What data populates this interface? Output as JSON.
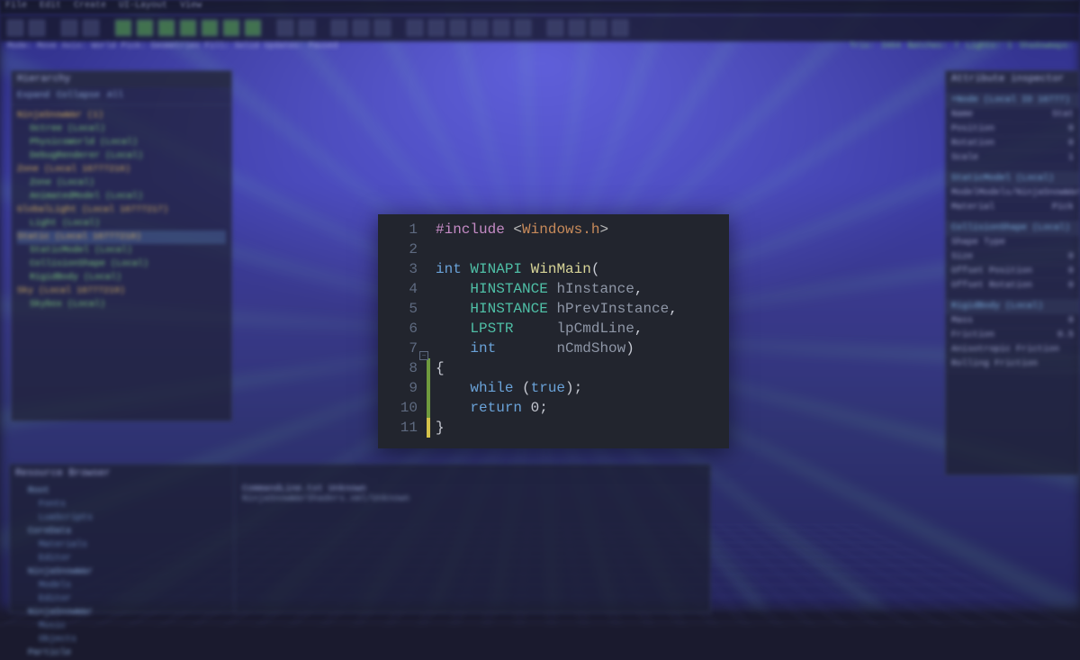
{
  "menu": [
    "File",
    "Edit",
    "Create",
    "UI-Layout",
    "View"
  ],
  "status_left": [
    "Mode:",
    "Move",
    "Axis:",
    "World",
    "Pick:",
    "Geometries",
    "Fill:",
    "Solid",
    "Updates:",
    "Paused"
  ],
  "status_right": [
    "Tris:",
    "3464",
    "Batches:",
    "7",
    "Lights:",
    "1",
    "Shadowmaps:"
  ],
  "hierarchy": {
    "title": "Hierarchy",
    "controls": [
      "Expand",
      "Collapse",
      "All"
    ],
    "items": [
      {
        "label": "NinjaSnowWar (1)",
        "cls": "l1"
      },
      {
        "label": "Octree (Local)",
        "cls": "l2"
      },
      {
        "label": "PhysicsWorld (Local)",
        "cls": "l2"
      },
      {
        "label": "DebugRenderer (Local)",
        "cls": "l2"
      },
      {
        "label": "Zone (Local 16777216)",
        "cls": "l1"
      },
      {
        "label": "Zone (Local)",
        "cls": "l2"
      },
      {
        "label": "AnimatedModel (Local)",
        "cls": "l2"
      },
      {
        "label": "GlobalLight (Local 16777217)",
        "cls": "l1"
      },
      {
        "label": "Light (Local)",
        "cls": "l2"
      },
      {
        "label": "Static (Local 16777218)",
        "cls": "l1 hl"
      },
      {
        "label": "StaticModel (Local)",
        "cls": "l2"
      },
      {
        "label": "CollisionShape (Local)",
        "cls": "l2"
      },
      {
        "label": "RigidBody (Local)",
        "cls": "l2"
      },
      {
        "label": "Sky (Local 16777219)",
        "cls": "l1"
      },
      {
        "label": "Skybox (Local)",
        "cls": "l2"
      }
    ]
  },
  "inspector": {
    "title": "Attribute inspector",
    "node_header": "+Node (Local ID 16777)",
    "rows": [
      {
        "k": "Name",
        "v": "Stat"
      },
      {
        "k": "Position",
        "v": "0"
      },
      {
        "k": "Rotation",
        "v": "0"
      },
      {
        "k": "Scale",
        "v": "1"
      }
    ],
    "sections": [
      {
        "title": "StaticModel (Local)",
        "rows": [
          {
            "k": "Model",
            "v": "Models/NinjaSnowWar/Le"
          },
          {
            "k": "Material",
            "v": "Pick"
          }
        ]
      },
      {
        "title": "CollisionShape (Local)",
        "rows": [
          {
            "k": "Shape Type",
            "v": ""
          },
          {
            "k": "Size",
            "v": "0"
          },
          {
            "k": "Offset Position",
            "v": "0"
          },
          {
            "k": "Offset Rotation",
            "v": "0"
          }
        ]
      },
      {
        "title": "RigidBody (Local)",
        "rows": [
          {
            "k": "Mass",
            "v": "0"
          },
          {
            "k": "Friction",
            "v": "0.5"
          },
          {
            "k": "Anisotropic Friction",
            "v": ""
          },
          {
            "k": "Rolling Friction",
            "v": ""
          }
        ]
      }
    ]
  },
  "browser": {
    "title": "Resource Browser",
    "folders": [
      "Root",
      "Fonts",
      "LuaScripts",
      "CoreData",
      "Materials",
      "Editor",
      "NinjaSnowWar",
      "Models",
      "Editor",
      "NinjaSnowWar",
      "Music",
      "Objects",
      "Particle"
    ],
    "files_header": [
      "CommandLine.txt",
      "Unknown"
    ],
    "files_body": "NinjaSnowWarShaders.xml/Unknown"
  },
  "code": {
    "lines": [
      {
        "n": 1,
        "tokens": [
          {
            "c": "inc",
            "t": "#include "
          },
          {
            "c": "lt",
            "t": "<"
          },
          {
            "c": "incf",
            "t": "Windows.h"
          },
          {
            "c": "lt",
            "t": ">"
          }
        ]
      },
      {
        "n": 2,
        "tokens": []
      },
      {
        "n": 3,
        "tokens": [
          {
            "c": "kw",
            "t": "int"
          },
          {
            "c": "",
            "t": " "
          },
          {
            "c": "type",
            "t": "WINAPI"
          },
          {
            "c": "",
            "t": " "
          },
          {
            "c": "func",
            "t": "WinMain"
          },
          {
            "c": "",
            "t": "("
          }
        ]
      },
      {
        "n": 4,
        "tokens": [
          {
            "c": "",
            "t": "    "
          },
          {
            "c": "type",
            "t": "HINSTANCE"
          },
          {
            "c": "",
            "t": " "
          },
          {
            "c": "param",
            "t": "hInstance"
          },
          {
            "c": "",
            "t": ","
          }
        ]
      },
      {
        "n": 5,
        "tokens": [
          {
            "c": "",
            "t": "    "
          },
          {
            "c": "type",
            "t": "HINSTANCE"
          },
          {
            "c": "",
            "t": " "
          },
          {
            "c": "param",
            "t": "hPrevInstance"
          },
          {
            "c": "",
            "t": ","
          }
        ]
      },
      {
        "n": 6,
        "tokens": [
          {
            "c": "",
            "t": "    "
          },
          {
            "c": "type",
            "t": "LPSTR"
          },
          {
            "c": "",
            "t": "     "
          },
          {
            "c": "param",
            "t": "lpCmdLine"
          },
          {
            "c": "",
            "t": ","
          }
        ]
      },
      {
        "n": 7,
        "tokens": [
          {
            "c": "",
            "t": "    "
          },
          {
            "c": "kw",
            "t": "int"
          },
          {
            "c": "",
            "t": "       "
          },
          {
            "c": "param",
            "t": "nCmdShow"
          },
          {
            "c": "",
            "t": ")"
          }
        ]
      },
      {
        "n": 8,
        "tokens": [
          {
            "c": "",
            "t": "{"
          }
        ]
      },
      {
        "n": 9,
        "tokens": [
          {
            "c": "",
            "t": "    "
          },
          {
            "c": "kw",
            "t": "while"
          },
          {
            "c": "",
            "t": " ("
          },
          {
            "c": "kw",
            "t": "true"
          },
          {
            "c": "",
            "t": ");"
          }
        ]
      },
      {
        "n": 10,
        "tokens": [
          {
            "c": "",
            "t": "    "
          },
          {
            "c": "kw",
            "t": "return"
          },
          {
            "c": "",
            "t": " 0;"
          }
        ]
      },
      {
        "n": 11,
        "tokens": [
          {
            "c": "",
            "t": "}"
          }
        ]
      }
    ],
    "change_marks": [
      "",
      "",
      "",
      "",
      "",
      "",
      "",
      "green",
      "green",
      "green",
      "yellow"
    ]
  }
}
